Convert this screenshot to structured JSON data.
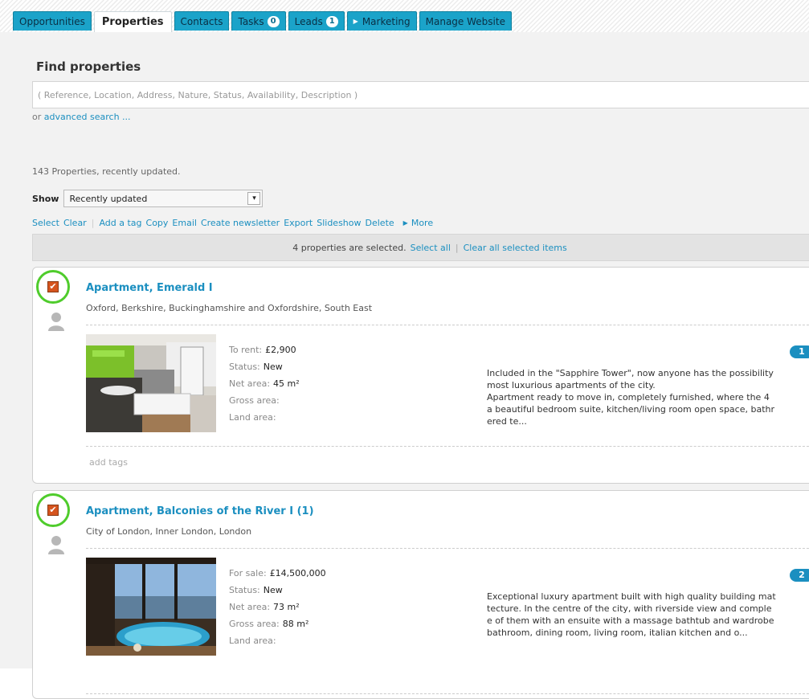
{
  "tabs": [
    {
      "label": "Opportunities"
    },
    {
      "label": "Properties"
    },
    {
      "label": "Contacts"
    },
    {
      "label": "Tasks",
      "badge": "0"
    },
    {
      "label": "Leads",
      "badge": "1"
    },
    {
      "label": "Marketing"
    },
    {
      "label": "Manage Website"
    }
  ],
  "search": {
    "title": "Find properties",
    "placeholder": "( Reference, Location, Address, Nature, Status, Availability, Description )",
    "or_text": "or",
    "advanced_link": "advanced search ..."
  },
  "summary": "143 Properties, recently updated.",
  "show": {
    "label": "Show",
    "selected": "Recently updated"
  },
  "actions": {
    "select": "Select",
    "clear": "Clear",
    "add_tag": "Add a tag",
    "copy": "Copy",
    "email": "Email",
    "create_newsletter": "Create newsletter",
    "export": "Export",
    "slideshow": "Slideshow",
    "delete": "Delete",
    "more": "More"
  },
  "selection_bar": {
    "text": "4 properties are selected.",
    "select_all": "Select all",
    "separator": "|",
    "clear_all": "Clear all selected items"
  },
  "properties": [
    {
      "title": "Apartment, Emerald I",
      "location": "Oxford, Berkshire, Buckinghamshire and Oxfordshire, South East",
      "price_label": "To rent:",
      "price": "£2,900",
      "status_label": "Status:",
      "status": "New",
      "net_label": "Net area:",
      "net": "45 m²",
      "gross_label": "Gross area:",
      "gross": "",
      "land_label": "Land area:",
      "land": "",
      "badge": "1",
      "description": [
        "Included in the \"Sapphire Tower\", now anyone has the possibility",
        "most luxurious apartments of the city.",
        "Apartment ready to move in, completely furnished, where the 4",
        "a beautiful bedroom suite, kitchen/living room open space, bathr",
        "ered te..."
      ],
      "add_tags": "add tags",
      "checked": true
    },
    {
      "title": "Apartment, Balconies of the River I (1)",
      "location": "City of London, Inner London, London",
      "price_label": "For sale:",
      "price": "£14,500,000",
      "status_label": "Status:",
      "status": "New",
      "net_label": "Net area:",
      "net": "73 m²",
      "gross_label": "Gross area:",
      "gross": "88 m²",
      "land_label": "Land area:",
      "land": "",
      "badge": "2",
      "description": [
        "Exceptional luxury apartment built with high quality building mat",
        "tecture. In the centre of the city, with riverside view and comple",
        "e of them with an ensuite with a massage bathtub and wardrobe",
        "bathroom, dining room, living room, italian kitchen and o..."
      ],
      "checked": true
    }
  ],
  "colors": {
    "tab": "#1ba3c9",
    "link": "#1b8fc0",
    "check_ring": "#4fcc2c",
    "checkbox": "#d5541e"
  }
}
